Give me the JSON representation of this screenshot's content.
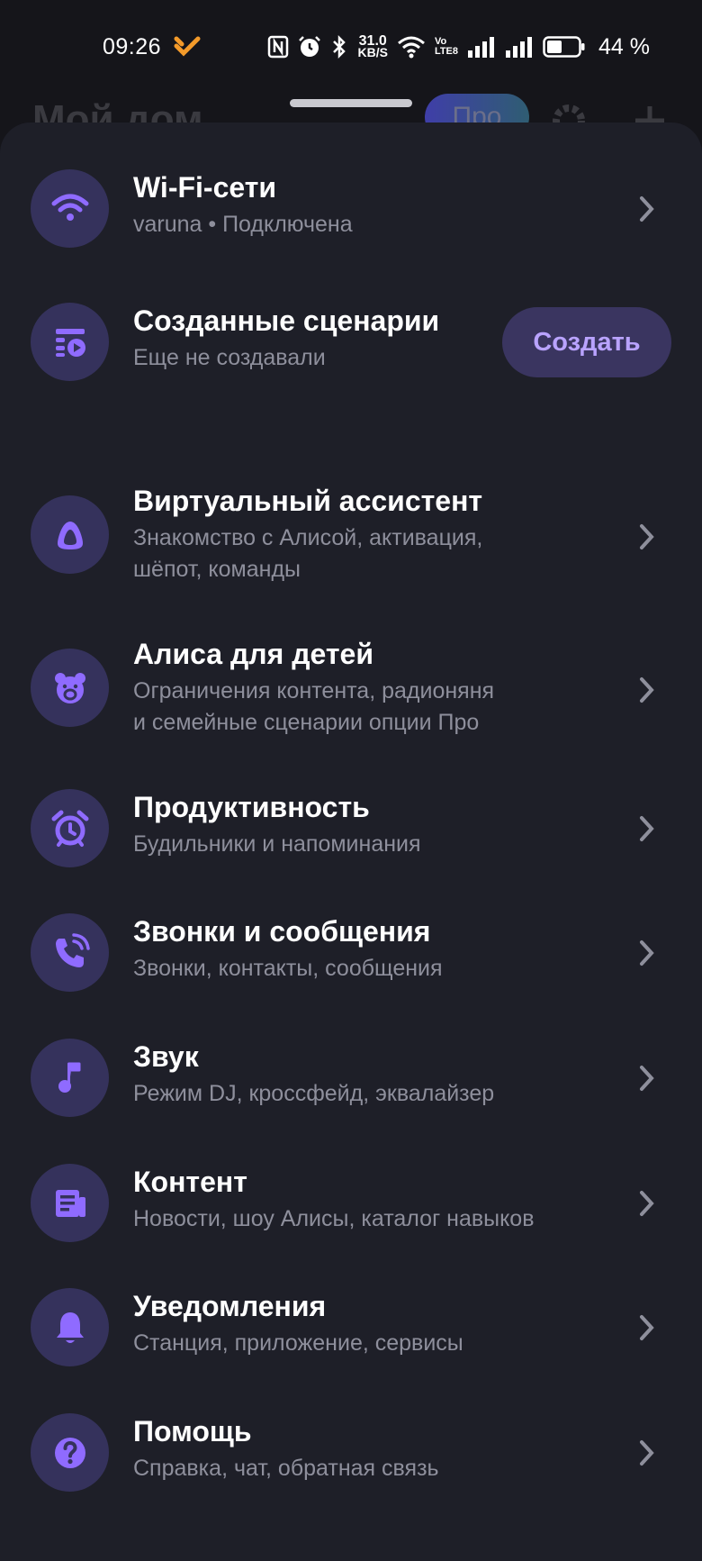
{
  "status_bar": {
    "time": "09:26",
    "net_speed_value": "31.0",
    "net_speed_unit": "KB/S",
    "volte_top": "Vo",
    "volte_bottom": "LTE8",
    "battery_percent": "44 %"
  },
  "background_header": {
    "title": "Мой дом",
    "pro_label": "Про"
  },
  "rows": [
    {
      "id": "wifi",
      "title": "Wi-Fi-сети",
      "subtitle": "varuna • Подключена",
      "icon": "wifi-icon"
    },
    {
      "id": "scenarios",
      "title": "Созданные сценарии",
      "subtitle": "Еще не создавали",
      "icon": "scenario-icon",
      "button_label": "Создать"
    },
    {
      "id": "assistant",
      "title": "Виртуальный ассистент",
      "subtitle_line1": "Знакомство с Алисой, активация,",
      "subtitle_line2": "шёпот, команды",
      "icon": "alice-icon"
    },
    {
      "id": "kids",
      "title": "Алиса для детей",
      "subtitle_line1": "Ограничения контента, радионяня",
      "subtitle_line2": "и семейные сценарии опции Про",
      "icon": "bear-icon"
    },
    {
      "id": "productivity",
      "title": "Продуктивность",
      "subtitle": "Будильники и напоминания",
      "icon": "alarm-clock-icon"
    },
    {
      "id": "calls",
      "title": "Звонки и сообщения",
      "subtitle": "Звонки, контакты, сообщения",
      "icon": "phone-call-icon"
    },
    {
      "id": "sound",
      "title": "Звук",
      "subtitle": "Режим DJ, кроссфейд, эквалайзер",
      "icon": "music-note-icon"
    },
    {
      "id": "content",
      "title": "Контент",
      "subtitle": "Новости, шоу Алисы, каталог навыков",
      "icon": "newspaper-icon"
    },
    {
      "id": "notifications",
      "title": "Уведомления",
      "subtitle": "Станция, приложение, сервисы",
      "icon": "bell-icon"
    },
    {
      "id": "help",
      "title": "Помощь",
      "subtitle": "Справка, чат, обратная связь",
      "icon": "question-icon"
    }
  ],
  "colors": {
    "sheet_background": "#1e1f28",
    "icon_circle": "#35325c",
    "icon_accent": "#8f6bff",
    "button_background": "#3a3560",
    "button_text": "#b9a3ff",
    "subtitle_text": "#8e8f9c"
  }
}
